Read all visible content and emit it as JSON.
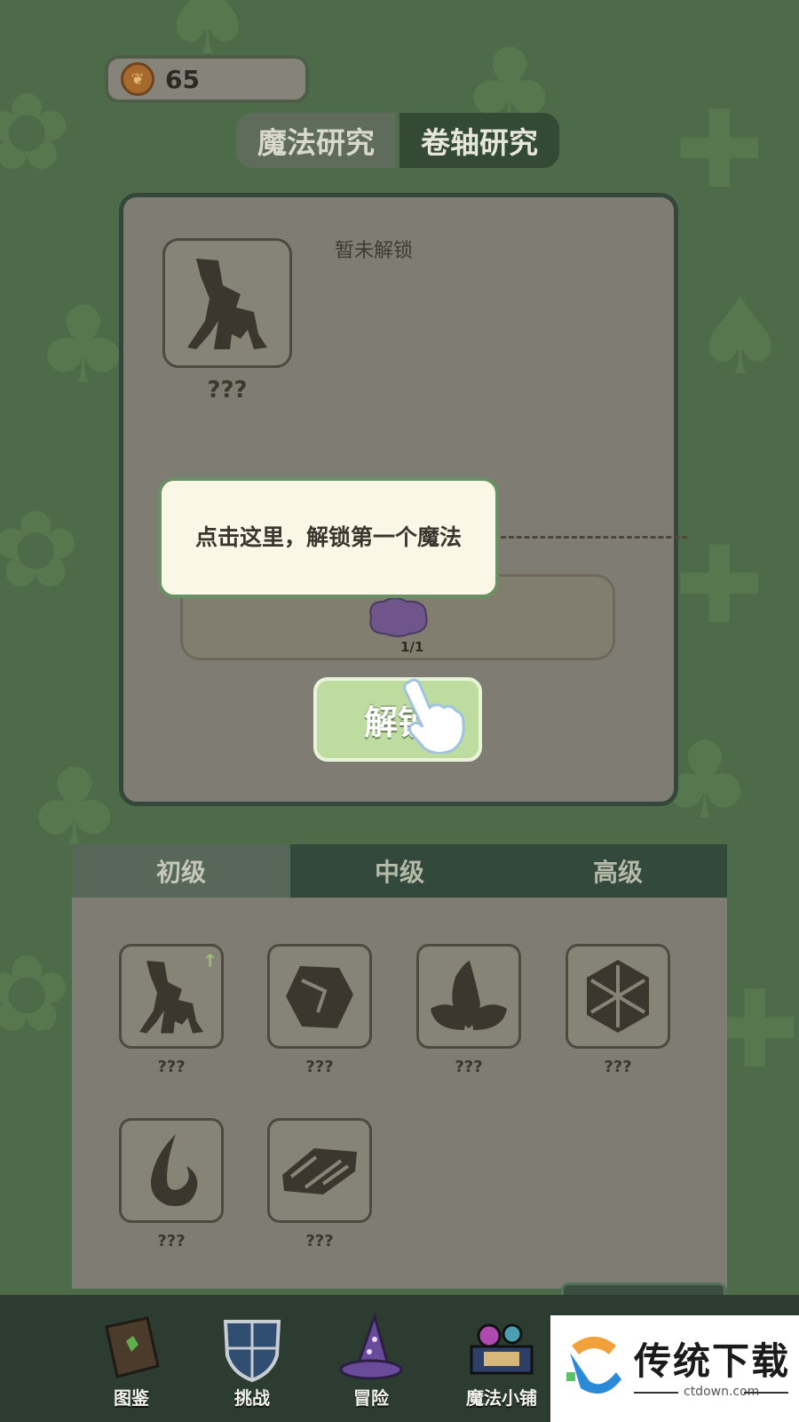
{
  "coins": {
    "value": "65"
  },
  "research_tabs": [
    {
      "label": "魔法研究",
      "active": true
    },
    {
      "label": "卷轴研究",
      "active": false
    }
  ],
  "detail": {
    "spell_name": "???",
    "status": "暂未解锁",
    "material_count": "1/1",
    "unlock_label": "解锁"
  },
  "tooltip": {
    "text": "点击这里，解锁第一个魔法"
  },
  "level_tabs": [
    {
      "label": "初级",
      "active": true
    },
    {
      "label": "中级",
      "active": false
    },
    {
      "label": "高级",
      "active": false
    }
  ],
  "spells": [
    {
      "icon": "tree-branch-icon",
      "label": "???"
    },
    {
      "icon": "rock-icon",
      "label": "???"
    },
    {
      "icon": "leaf-icon",
      "label": "???"
    },
    {
      "icon": "snowflake-icon",
      "label": "???"
    },
    {
      "icon": "flame-icon",
      "label": "???"
    },
    {
      "icon": "metal-ingot-icon",
      "label": "???"
    }
  ],
  "bottom_nav": [
    {
      "label": "图鉴",
      "icon": "book-icon"
    },
    {
      "label": "挑战",
      "icon": "shield-icon"
    },
    {
      "label": "冒险",
      "icon": "wizard-hat-icon"
    },
    {
      "label": "魔法小铺",
      "icon": "potion-shop-icon"
    }
  ],
  "watermark": {
    "text": "传统下载",
    "url": "ctdown.com"
  },
  "colors": {
    "accent_green": "#bfdca0",
    "background": "#4d6b49",
    "panel": "#7f7d73"
  }
}
